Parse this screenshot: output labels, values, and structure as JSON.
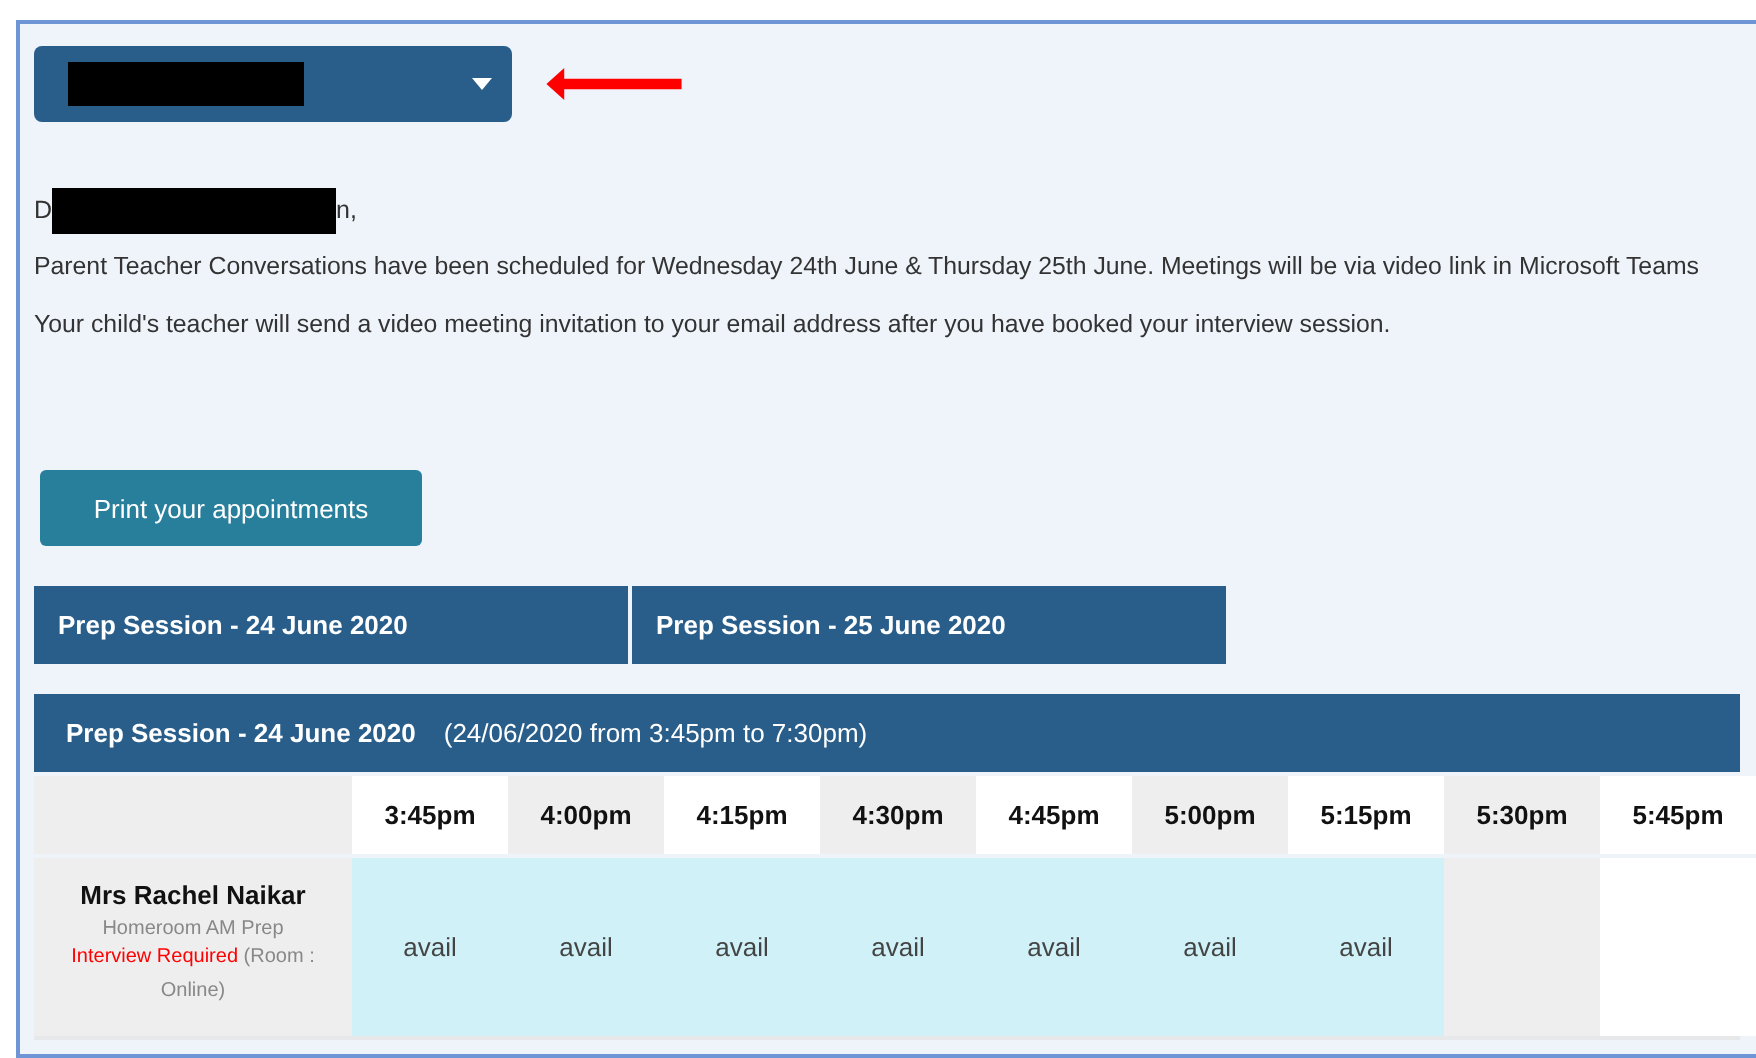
{
  "student_select": {
    "redacted": true
  },
  "greeting": {
    "start": "D",
    "end": "n,",
    "redacted": true
  },
  "paragraphs": [
    "Parent Teacher Conversations have been scheduled for Wednesday 24th June & Thursday 25th June.  Meetings will be via video link in Microsoft Teams",
    "Your child's teacher will send a video meeting invitation to your email address after you have booked your interview session."
  ],
  "print_button": "Print your appointments",
  "session_tabs": [
    {
      "label": "Prep Session - 24 June 2020"
    },
    {
      "label": "Prep Session - 25 June 2020"
    }
  ],
  "schedule": {
    "title": "Prep Session - 24 June 2020",
    "subtitle": "(24/06/2020 from 3:45pm to 7:30pm)",
    "times": [
      "3:45pm",
      "4:00pm",
      "4:15pm",
      "4:30pm",
      "4:45pm",
      "5:00pm",
      "5:15pm",
      "5:30pm",
      "5:45pm"
    ],
    "teachers": [
      {
        "name": "Mrs Rachel Naikar",
        "class": "Homeroom AM Prep",
        "status": "Interview Required",
        "room": "(Room : Online)",
        "slots": [
          {
            "kind": "available",
            "text": "avail"
          },
          {
            "kind": "available",
            "text": "avail"
          },
          {
            "kind": "available",
            "text": "avail"
          },
          {
            "kind": "available",
            "text": "avail"
          },
          {
            "kind": "available",
            "text": "avail"
          },
          {
            "kind": "available",
            "text": "avail"
          },
          {
            "kind": "available",
            "text": "avail"
          },
          {
            "kind": "empty"
          },
          {
            "kind": "empty"
          }
        ]
      }
    ]
  }
}
